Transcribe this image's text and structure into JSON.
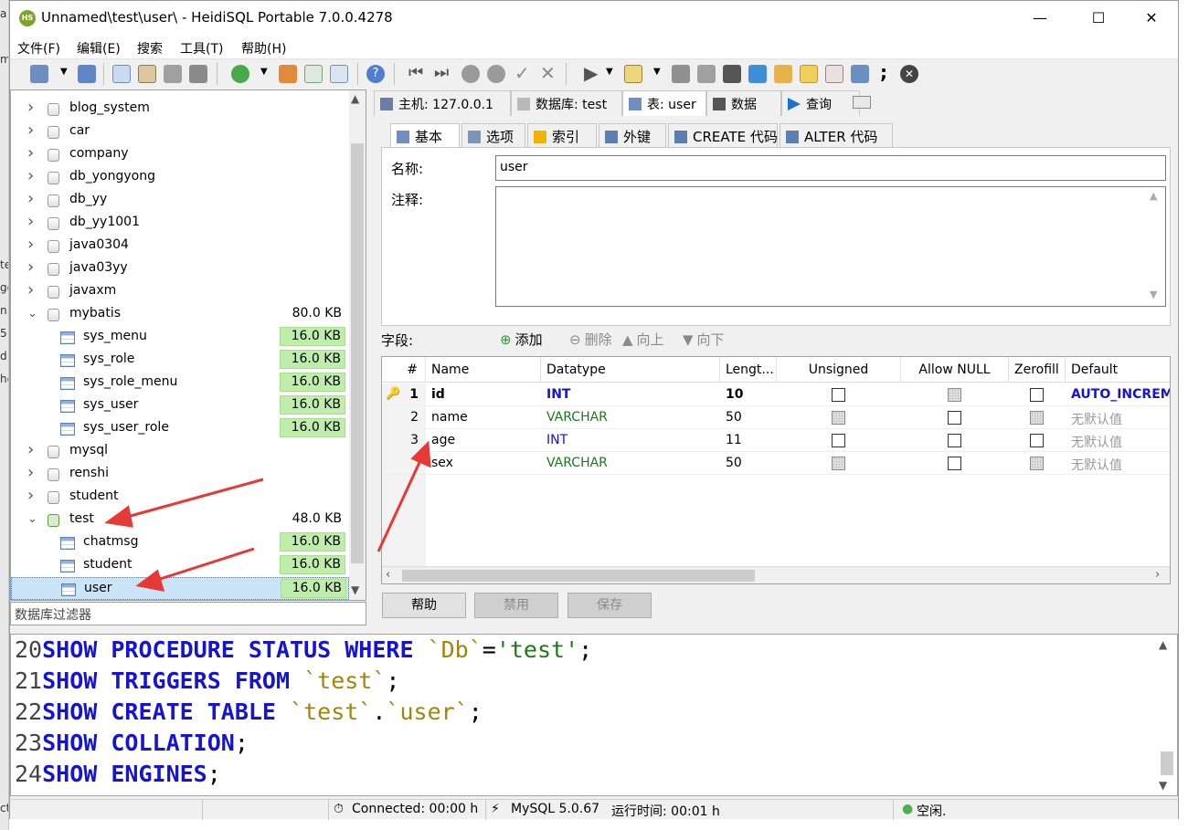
{
  "window": {
    "title": "Unnamed\\test\\user\\ - HeidiSQL Portable 7.0.0.4278"
  },
  "menu": [
    "文件(F)",
    "编辑(E)",
    "搜索",
    "工具(T)",
    "帮助(H)"
  ],
  "left_strip_fragments": [
    "a",
    "m",
    "te",
    "ge",
    "n.",
    "5",
    "d",
    "he",
    "ct"
  ],
  "tree": {
    "items": [
      {
        "label": "blog_system",
        "indent": 0,
        "expanded": false
      },
      {
        "label": "car",
        "indent": 0,
        "expanded": false
      },
      {
        "label": "company",
        "indent": 0,
        "expanded": false
      },
      {
        "label": "db_yongyong",
        "indent": 0,
        "expanded": false
      },
      {
        "label": "db_yy",
        "indent": 0,
        "expanded": false
      },
      {
        "label": "db_yy1001",
        "indent": 0,
        "expanded": false
      },
      {
        "label": "java0304",
        "indent": 0,
        "expanded": false
      },
      {
        "label": "java03yy",
        "indent": 0,
        "expanded": false
      },
      {
        "label": "javaxm",
        "indent": 0,
        "expanded": false
      },
      {
        "label": "mybatis",
        "indent": 0,
        "expanded": true,
        "size": "80.0 KB"
      },
      {
        "label": "sys_menu",
        "indent": 1,
        "size": "16.0 KB"
      },
      {
        "label": "sys_role",
        "indent": 1,
        "size": "16.0 KB"
      },
      {
        "label": "sys_role_menu",
        "indent": 1,
        "size": "16.0 KB"
      },
      {
        "label": "sys_user",
        "indent": 1,
        "size": "16.0 KB"
      },
      {
        "label": "sys_user_role",
        "indent": 1,
        "size": "16.0 KB"
      },
      {
        "label": "mysql",
        "indent": 0,
        "expanded": false
      },
      {
        "label": "renshi",
        "indent": 0,
        "expanded": false
      },
      {
        "label": "student",
        "indent": 0,
        "expanded": false
      },
      {
        "label": "test",
        "indent": 0,
        "expanded": true,
        "size": "48.0 KB"
      },
      {
        "label": "chatmsg",
        "indent": 1,
        "size": "16.0 KB"
      },
      {
        "label": "student",
        "indent": 1,
        "size": "16.0 KB"
      },
      {
        "label": "user",
        "indent": 1,
        "size": "16.0 KB",
        "selected": true
      }
    ]
  },
  "filter_placeholder": "数据库过滤器",
  "main_tabs": [
    {
      "label": "主机: 127.0.0.1",
      "icon": "host-icon"
    },
    {
      "label": "数据库: test",
      "icon": "database-icon"
    },
    {
      "label": "表: user",
      "icon": "table-icon",
      "active": true
    },
    {
      "label": "数据",
      "icon": "data-icon"
    },
    {
      "label": "查询",
      "icon": "play-icon"
    }
  ],
  "sub_tabs": [
    {
      "label": "基本",
      "icon": "table-icon",
      "active": true
    },
    {
      "label": "选项",
      "icon": "wrench-icon"
    },
    {
      "label": "索引",
      "icon": "lightning-icon"
    },
    {
      "label": "外键",
      "icon": "foreign-key-icon"
    },
    {
      "label": "CREATE 代码",
      "icon": "code-icon"
    },
    {
      "label": "ALTER 代码",
      "icon": "code-icon"
    }
  ],
  "props": {
    "name_label": "名称:",
    "name_value": "user",
    "comment_label": "注释:",
    "comment_value": ""
  },
  "fields": {
    "label": "字段:",
    "actions": [
      {
        "label": "添加",
        "icon": "add-icon",
        "enabled": true
      },
      {
        "label": "删除",
        "icon": "remove-icon",
        "enabled": false
      },
      {
        "label": "向上",
        "icon": "up-icon",
        "enabled": false
      },
      {
        "label": "向下",
        "icon": "down-icon",
        "enabled": false
      }
    ],
    "columns": [
      "#",
      "Name",
      "Datatype",
      "Lengt...",
      "Unsigned",
      "Allow NULL",
      "Zerofill",
      "Default"
    ],
    "rows": [
      {
        "num": "1",
        "name": "id",
        "type": "INT",
        "length": "10",
        "unsigned": false,
        "unsigned_enabled": true,
        "allow_null": false,
        "allow_null_enabled": false,
        "zerofill": false,
        "zerofill_enabled": true,
        "default": "AUTO_INCREMENT",
        "primary": true
      },
      {
        "num": "2",
        "name": "name",
        "type": "VARCHAR",
        "length": "50",
        "unsigned": false,
        "unsigned_enabled": false,
        "allow_null": false,
        "allow_null_enabled": true,
        "zerofill": false,
        "zerofill_enabled": false,
        "default": "无默认值",
        "primary": false
      },
      {
        "num": "3",
        "name": "age",
        "type": "INT",
        "length": "11",
        "unsigned": false,
        "unsigned_enabled": true,
        "allow_null": false,
        "allow_null_enabled": true,
        "zerofill": false,
        "zerofill_enabled": true,
        "default": "无默认值",
        "primary": false
      },
      {
        "num": "",
        "name": "sex",
        "type": "VARCHAR",
        "length": "50",
        "unsigned": false,
        "unsigned_enabled": false,
        "allow_null": false,
        "allow_null_enabled": true,
        "zerofill": false,
        "zerofill_enabled": false,
        "default": "无默认值",
        "primary": false
      }
    ]
  },
  "buttons": {
    "help": "帮助",
    "disable": "禁用",
    "save": "保存"
  },
  "sql_log": [
    {
      "ln": "20",
      "parts": [
        [
          "kw",
          "SHOW PROCEDURE STATUS WHERE "
        ],
        [
          "str",
          "`Db`"
        ],
        [
          "plain",
          "="
        ],
        [
          "strg",
          "'test'"
        ],
        [
          "plain",
          ";"
        ]
      ]
    },
    {
      "ln": "21",
      "parts": [
        [
          "kw",
          "SHOW TRIGGERS FROM "
        ],
        [
          "str",
          "`test`"
        ],
        [
          "plain",
          ";"
        ]
      ]
    },
    {
      "ln": "22",
      "parts": [
        [
          "kw",
          "SHOW CREATE TABLE "
        ],
        [
          "str",
          "`test`"
        ],
        [
          "plain",
          "."
        ],
        [
          "str",
          "`user`"
        ],
        [
          "plain",
          ";"
        ]
      ]
    },
    {
      "ln": "23",
      "parts": [
        [
          "kw",
          "SHOW COLLATION"
        ],
        [
          "plain",
          ";"
        ]
      ]
    },
    {
      "ln": "24",
      "parts": [
        [
          "kw",
          "SHOW ENGINES"
        ],
        [
          "plain",
          ";"
        ]
      ]
    }
  ],
  "status": {
    "connected": "Connected: 00:00 h",
    "server": "MySQL 5.0.67",
    "runtime": "运行时间: 00:01 h",
    "state": "空闲."
  },
  "colors": {
    "int": "#1414d2",
    "varchar": "#1b7a1b",
    "default_muted": "#9a9a9a",
    "badge": "#bfeeaa",
    "arrow": "#e53935"
  }
}
